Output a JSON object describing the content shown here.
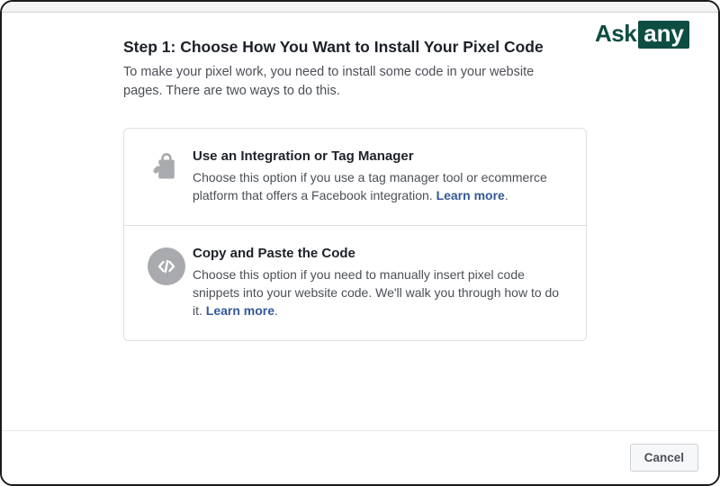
{
  "logo": {
    "ask": "Ask",
    "any": "any"
  },
  "header": {
    "title": "Step 1: Choose How You Want to Install Your Pixel Code",
    "subtitle": "To make your pixel work, you need to install some code in your website pages. There are two ways to do this."
  },
  "options": {
    "integration": {
      "title": "Use an Integration or Tag Manager",
      "desc": "Choose this option if you use a tag manager tool or ecommerce platform that offers a Facebook integration. ",
      "learn_more": "Learn more"
    },
    "copypaste": {
      "title": "Copy and Paste the Code",
      "desc_1": "Choose this option if you need to manually insert pixel code snippets into your website code. We'll walk you through how to do it. ",
      "learn_more": "Learn more"
    }
  },
  "footer": {
    "cancel": "Cancel"
  },
  "icons": {
    "shopping_tag": "shopping-tag-icon",
    "code": "code-icon"
  }
}
